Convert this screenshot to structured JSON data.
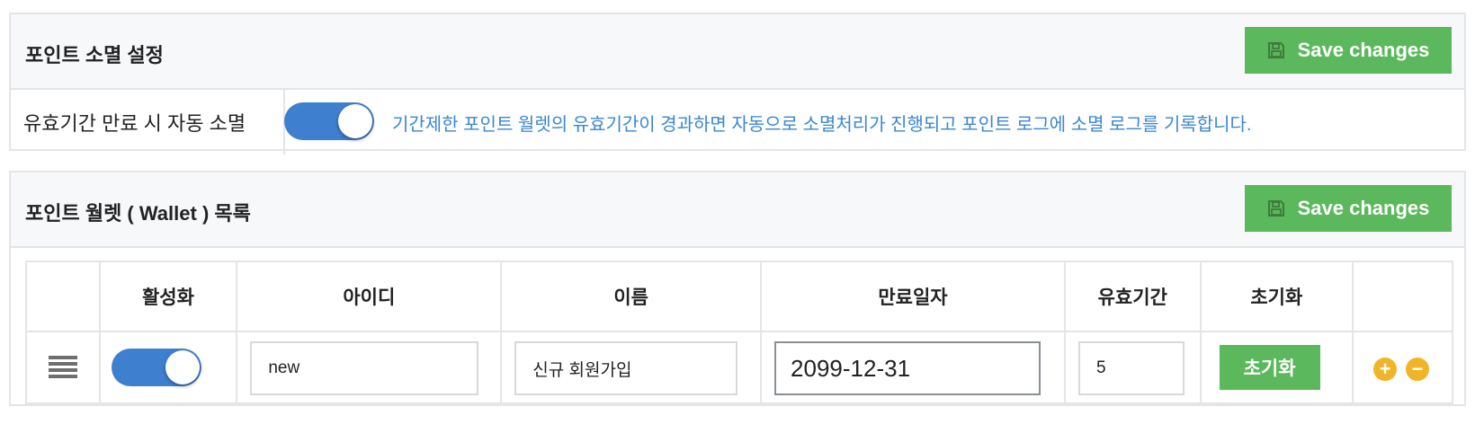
{
  "expiration_panel": {
    "title": "포인트 소멸 설정",
    "save_label": "Save changes",
    "setting": {
      "label": "유효기간 만료 시 자동 소멸",
      "enabled": true,
      "description": "기간제한 포인트 월렛의 유효기간이 경과하면 자동으로 소멸처리가 진행되고 포인트 로그에 소멸 로그를 기록합니다."
    }
  },
  "wallet_panel": {
    "title": "포인트 월렛 ( Wallet ) 목록",
    "save_label": "Save changes",
    "columns": [
      "",
      "활성화",
      "아이디",
      "이름",
      "만료일자",
      "유효기간",
      "초기화",
      ""
    ],
    "rows": [
      {
        "active": true,
        "id": "new",
        "name": "신규 회원가입",
        "expiry_date": "2099-12-31",
        "valid_period": "5",
        "reset_label": "초기화"
      }
    ]
  },
  "icons": {
    "save": "floppy-disk-icon",
    "drag": "drag-handle-icon",
    "add": "plus-circle-icon",
    "remove": "minus-circle-icon"
  },
  "colors": {
    "primary_green": "#5cb85c",
    "toggle_blue": "#3e7fd0",
    "desc_blue": "#3a86d4",
    "action_orange": "#f0b428",
    "border": "#e3e5e8"
  }
}
